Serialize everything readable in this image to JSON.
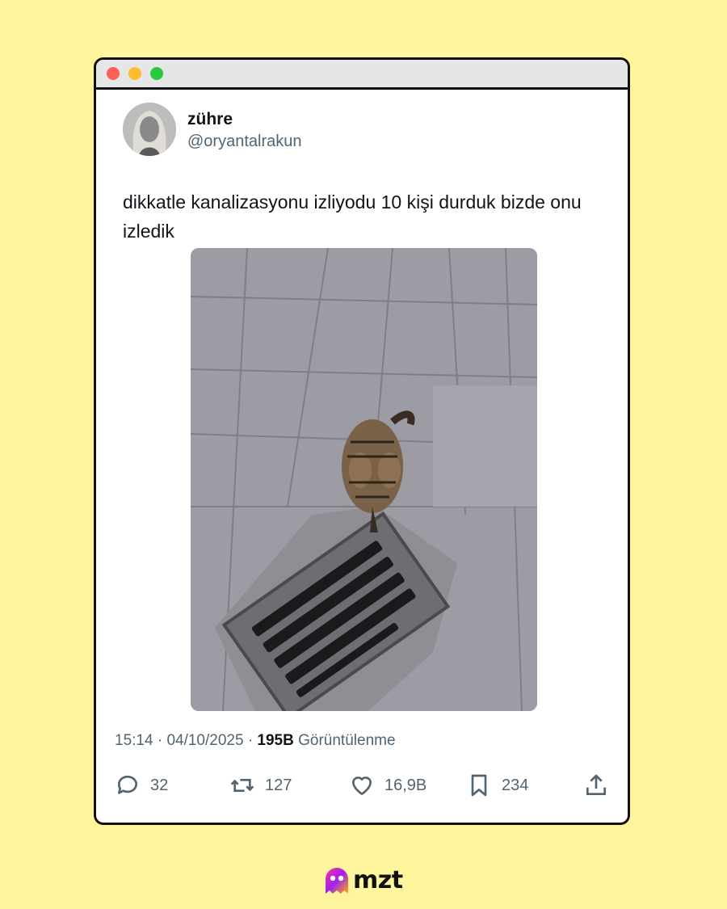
{
  "window": {
    "controls": {
      "close_color": "#ff5f57",
      "minimize_color": "#febc2e",
      "maximize_color": "#28c840"
    }
  },
  "tweet": {
    "author_name": "zühre",
    "author_handle": "@oryantalrakun",
    "text": "dikkatle kanalizasyonu izliyodu 10 kişi durduk bizde onu izledik",
    "image_description_icon": "cat-over-drain-photo",
    "time": "15:14",
    "separator": "·",
    "date": "04/10/2025",
    "views_count": "195B",
    "views_label": "Görüntülenme",
    "replies": "32",
    "retweets": "127",
    "likes": "16,9B",
    "bookmarks": "234"
  },
  "brand": {
    "name": "mzt",
    "accent": "#a020f0"
  },
  "colors": {
    "background": "#fff59d",
    "muted_text": "#536471"
  }
}
